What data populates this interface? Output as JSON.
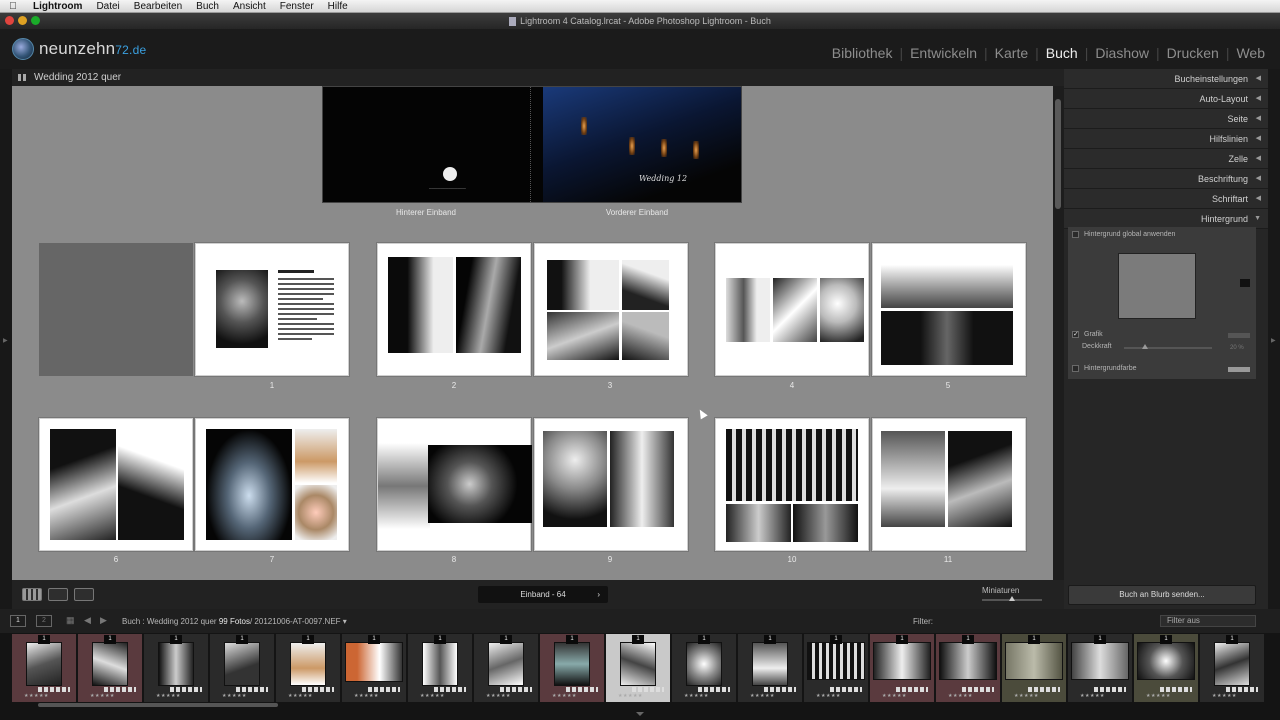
{
  "menubar": {
    "app": "Lightroom",
    "items": [
      "Datei",
      "Bearbeiten",
      "Buch",
      "Ansicht",
      "Fenster",
      "Hilfe"
    ]
  },
  "window": {
    "title": "Lightroom 4 Catalog.lrcat - Adobe Photoshop Lightroom - Buch"
  },
  "header": {
    "logo_text": "neunzehn",
    "logo_accent": "72.de",
    "modules": [
      "Bibliothek",
      "Entwickeln",
      "Karte",
      "Buch",
      "Diashow",
      "Drucken",
      "Web"
    ],
    "active_module": "Buch"
  },
  "center": {
    "book_title": "Wedding 2012 quer",
    "cover": {
      "back_label": "Hinterer Einband",
      "front_label": "Vorderer Einband",
      "title_text": "Wedding 12"
    },
    "page_numbers": [
      "1",
      "2",
      "3",
      "4",
      "5",
      "6",
      "7",
      "8",
      "9",
      "10",
      "11"
    ],
    "pager_label": "Einband - 64",
    "miniatures_label": "Miniaturen",
    "miniatures_value": 0.5
  },
  "right_panel": {
    "sections": [
      "Bucheinstellungen",
      "Auto-Layout",
      "Seite",
      "Hilfslinien",
      "Zelle",
      "Beschriftung",
      "Schriftart",
      "Hintergrund"
    ],
    "background": {
      "global_label": "Hintergrund global anwenden",
      "grafik_label": "Grafik",
      "deckkraft_label": "Deckkraft",
      "deckkraft_value": "20 %",
      "farbe_label": "Hintergrundfarbe"
    },
    "blurb_button": "Buch an Blurb senden..."
  },
  "filmbar": {
    "screen1": "1",
    "screen2": "2",
    "crumb_prefix": "Buch : Wedding 2012 quer",
    "photo_count": "99 Fotos",
    "filename": "20121006-AT-0097.NEF",
    "filter_label": "Filter:",
    "filter_value": "Filter aus"
  },
  "filmstrip": {
    "badge": "1",
    "stars": "★★★★★"
  },
  "colors": {
    "accent": "#3aa0e0",
    "canvas": "#8b8b8b",
    "panel": "#262626"
  }
}
